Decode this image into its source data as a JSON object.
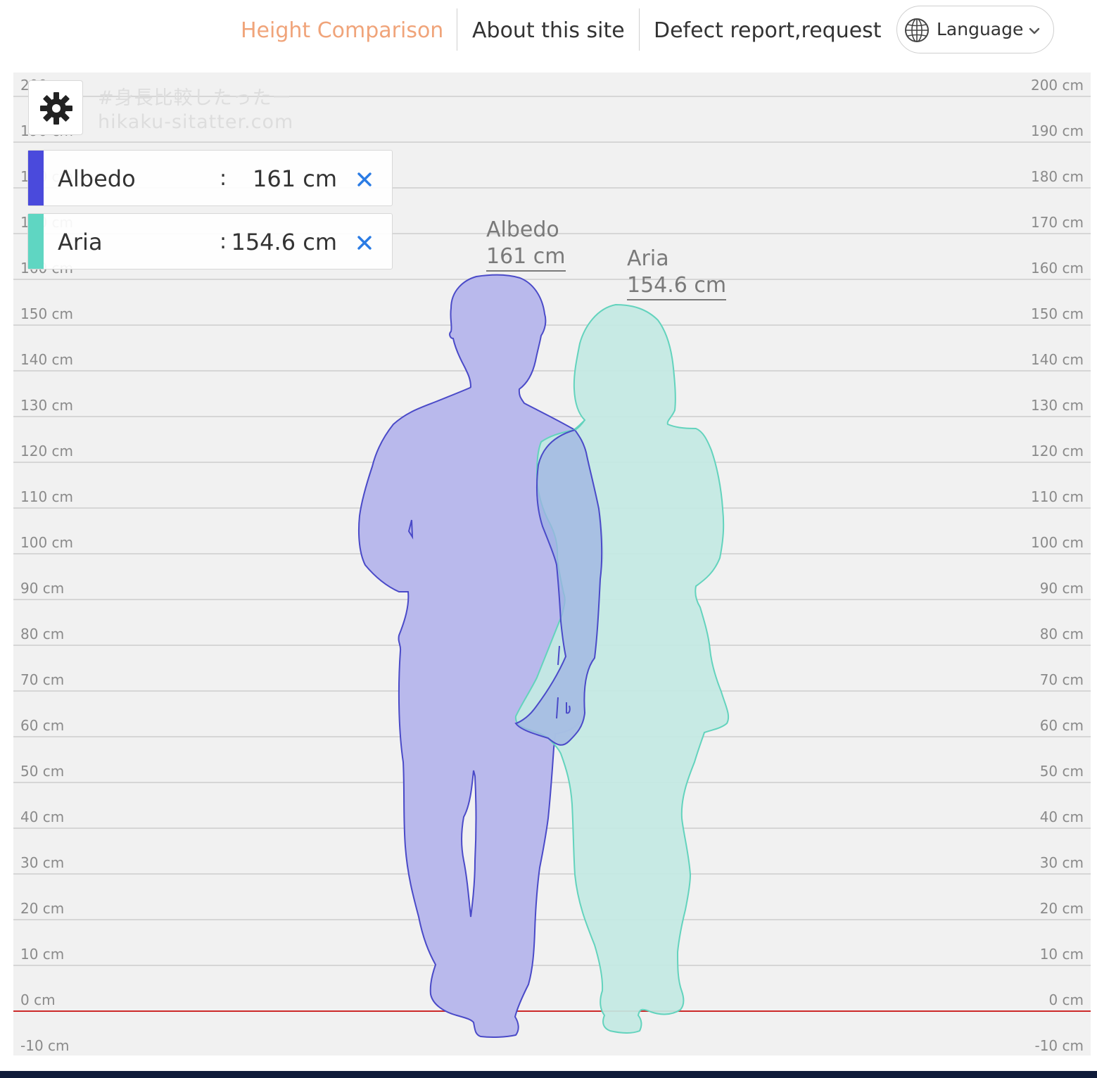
{
  "nav": {
    "items": [
      {
        "label": "Height Comparison",
        "active": true
      },
      {
        "label": "About this site",
        "active": false
      },
      {
        "label": "Defect report,request",
        "active": false
      }
    ],
    "language": {
      "label": "Language",
      "icon": "globe-icon"
    }
  },
  "watermark": {
    "line1": "#身長比較したったー",
    "line2": "hikaku-sitatter.com"
  },
  "settings": {
    "icon": "gear-icon"
  },
  "ticks": [
    "200 cm",
    "190 cm",
    "180 cm",
    "170 cm",
    "160 cm",
    "150 cm",
    "140 cm",
    "130 cm",
    "120 cm",
    "110 cm",
    "100 cm",
    "90 cm",
    "80 cm",
    "70 cm",
    "60 cm",
    "50 cm",
    "40 cm",
    "30 cm",
    "20 cm",
    "10 cm",
    "0 cm",
    "-10 cm"
  ],
  "entries": [
    {
      "name": "Albedo",
      "colon": ":",
      "height": "161 cm",
      "color": "#4a4adc",
      "remove_icon": "close-icon"
    },
    {
      "name": "Aria",
      "colon": ":",
      "height": "154.6 cm",
      "color": "#5fd6c2",
      "remove_icon": "close-icon"
    }
  ],
  "figures": [
    {
      "name": "Albedo",
      "height": "161 cm",
      "height_cm": 161,
      "fill": "#b9b9ec",
      "stroke": "#4a4ac8"
    },
    {
      "name": "Aria",
      "height": "154.6 cm",
      "height_cm": 154.6,
      "fill": "#c3e9e3",
      "stroke": "#63d3bd"
    }
  ],
  "colors": {
    "accent": "#f0a47a",
    "ground_line": "#cc2a2a",
    "chart_bg": "#f1f1f1"
  }
}
